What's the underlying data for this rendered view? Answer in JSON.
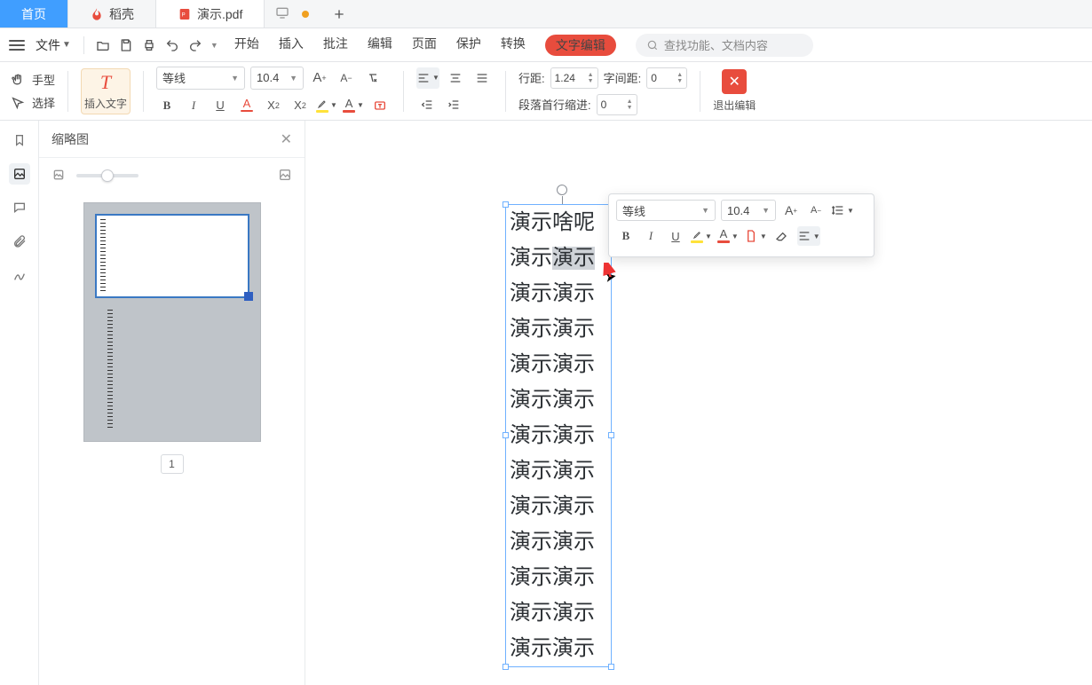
{
  "tabs": {
    "home": "首页",
    "template": "稻壳",
    "document": "演示.pdf"
  },
  "quickbar": {
    "file_label": "文件"
  },
  "menubar": {
    "items": [
      "开始",
      "插入",
      "批注",
      "编辑",
      "页面",
      "保护",
      "转换"
    ],
    "text_edit_pill": "文字编辑",
    "search_placeholder": "查找功能、文档内容"
  },
  "ribbon": {
    "hand_tool": "手型",
    "select_tool": "选择",
    "insert_text": "插入文字",
    "font_name": "等线",
    "font_size": "10.4",
    "line_spacing_label": "行距:",
    "line_spacing_value": "1.24",
    "char_spacing_label": "字间距:",
    "char_spacing_value": "0",
    "first_indent_label": "段落首行缩进:",
    "first_indent_value": "0",
    "exit_edit": "退出编辑"
  },
  "sidebar": {
    "thumbnail_title": "缩略图",
    "page_index": "1"
  },
  "document": {
    "lines": [
      "演示啥呢",
      "演示演示",
      "演示演示",
      "演示演示",
      "演示演示",
      "演示演示",
      "演示演示",
      "演示演示",
      "演示演示",
      "演示演示",
      "演示演示",
      "演示演示",
      "演示演示"
    ],
    "selected_line_index": 1,
    "selected_text": "演示"
  },
  "float_toolbar": {
    "font_name": "等线",
    "font_size": "10.4"
  },
  "colors": {
    "accent": "#409eff",
    "danger": "#e84c3d",
    "highlight": "#ffe23a"
  }
}
